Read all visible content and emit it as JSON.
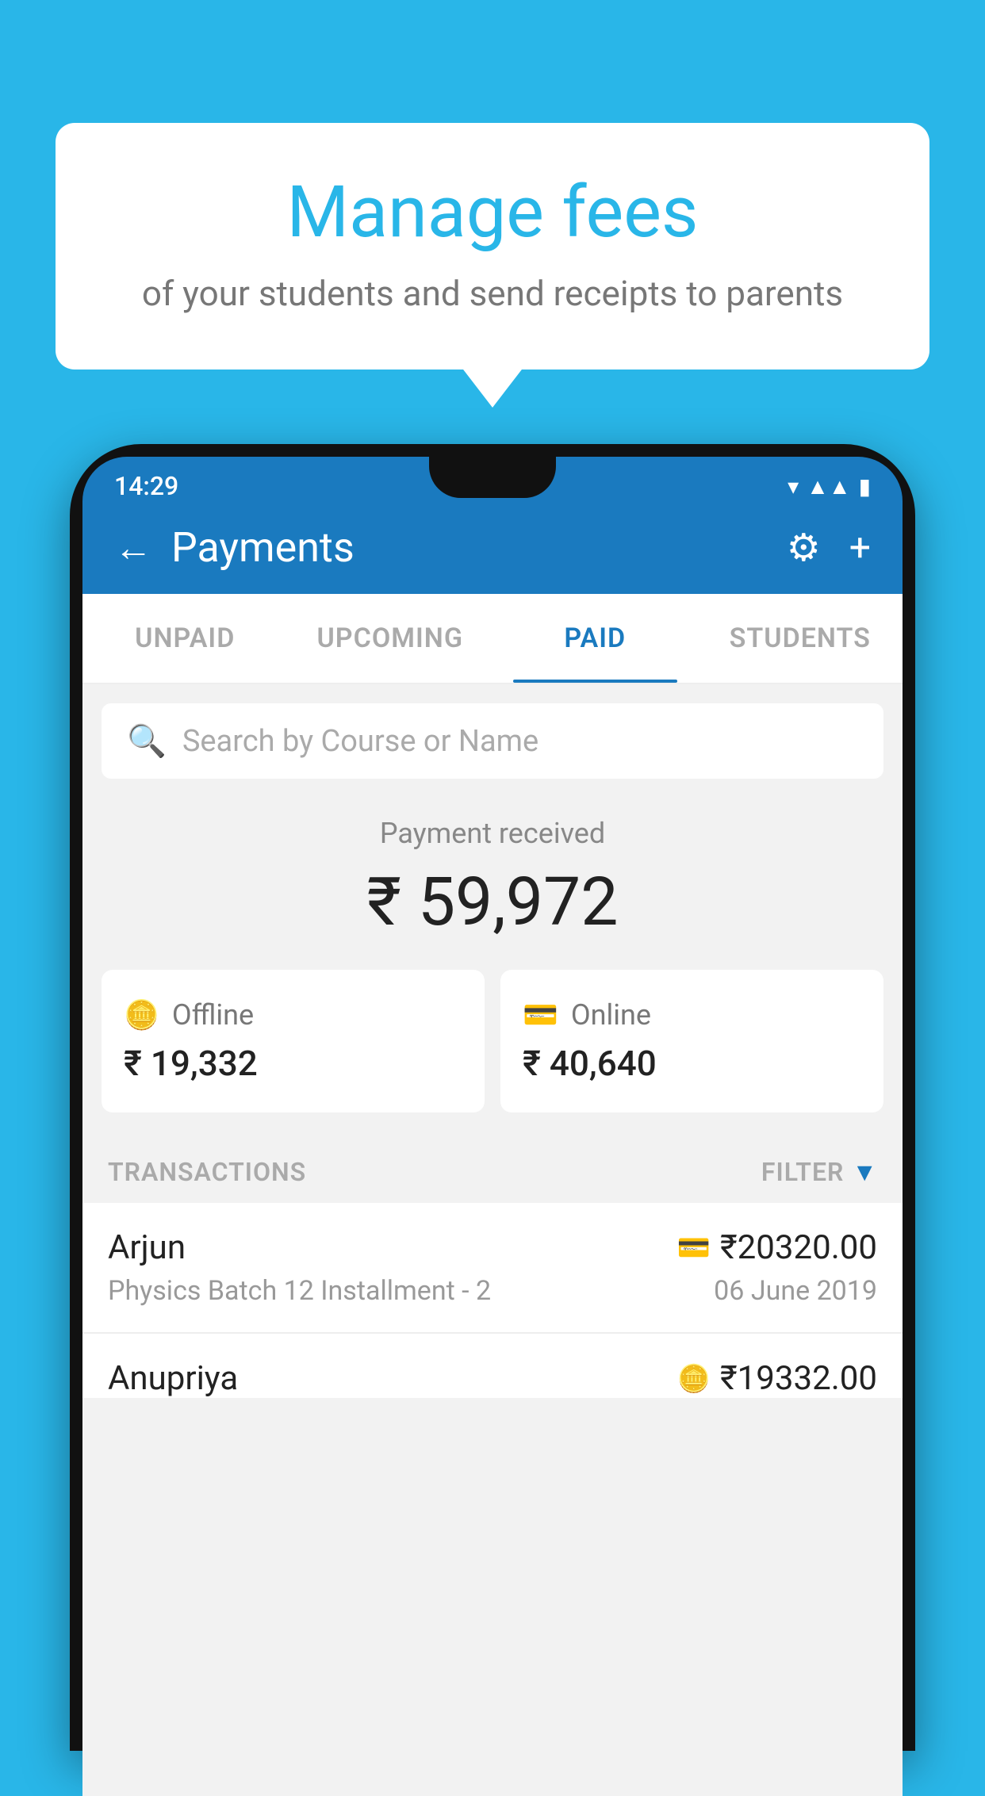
{
  "background_color": "#29b6e8",
  "bubble": {
    "title": "Manage fees",
    "subtitle": "of your students and send receipts to parents"
  },
  "phone": {
    "status_time": "14:29",
    "header": {
      "title": "Payments",
      "settings_icon": "⚙",
      "add_icon": "+",
      "back_icon": "←"
    },
    "tabs": [
      {
        "label": "UNPAID",
        "active": false
      },
      {
        "label": "UPCOMING",
        "active": false
      },
      {
        "label": "PAID",
        "active": true
      },
      {
        "label": "STUDENTS",
        "active": false
      }
    ],
    "search": {
      "placeholder": "Search by Course or Name"
    },
    "payment_received": {
      "label": "Payment received",
      "amount": "₹ 59,972",
      "offline_label": "Offline",
      "offline_amount": "₹ 19,332",
      "online_label": "Online",
      "online_amount": "₹ 40,640"
    },
    "transactions": {
      "label": "TRANSACTIONS",
      "filter_label": "FILTER",
      "rows": [
        {
          "name": "Arjun",
          "amount": "₹20320.00",
          "course": "Physics Batch 12 Installment - 2",
          "date": "06 June 2019",
          "payment_type": "card"
        },
        {
          "name": "Anupriya",
          "amount": "₹19332.00",
          "course": "",
          "date": "",
          "payment_type": "cash"
        }
      ]
    }
  }
}
